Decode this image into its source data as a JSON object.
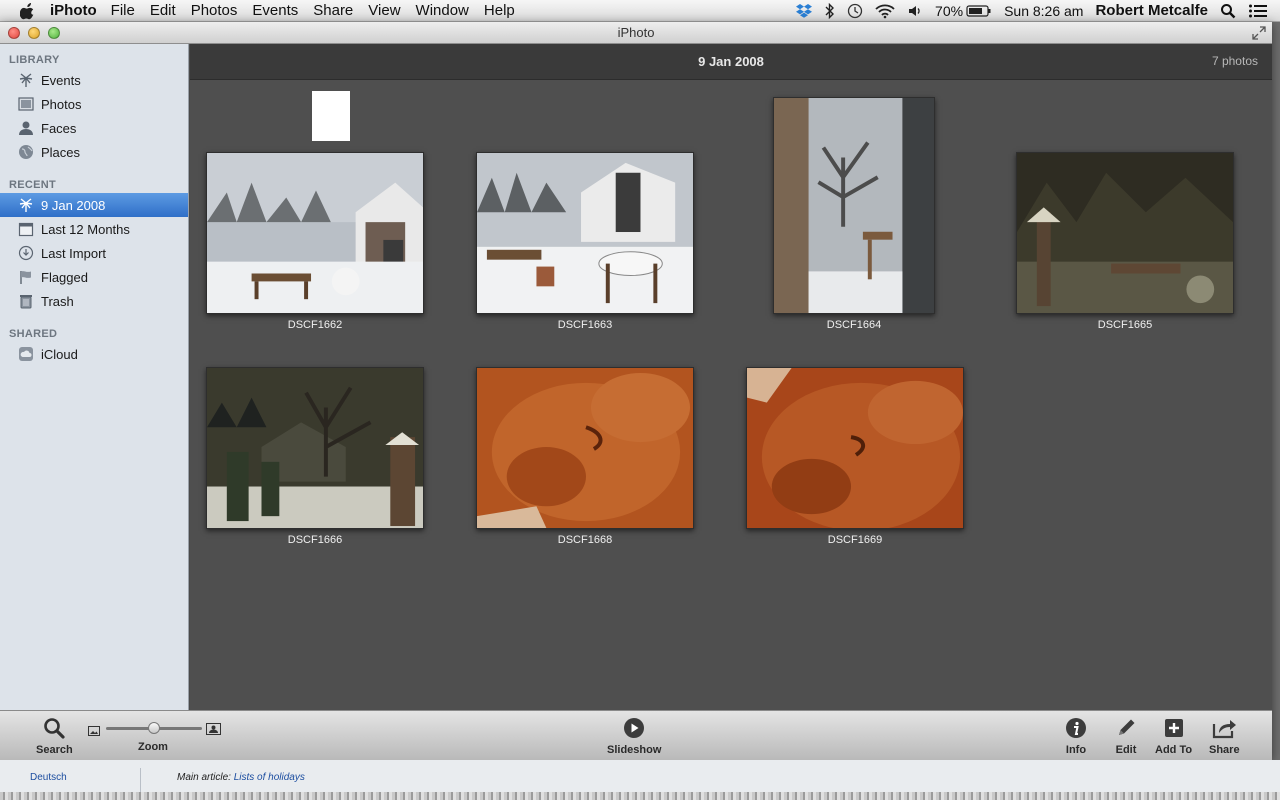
{
  "menubar": {
    "app_name": "iPhoto",
    "menus": [
      "File",
      "Edit",
      "Photos",
      "Events",
      "Share",
      "View",
      "Window",
      "Help"
    ],
    "battery": "70%",
    "clock": "Sun 8:26 am",
    "user": "Robert Metcalfe"
  },
  "window": {
    "title": "iPhoto"
  },
  "sidebar": {
    "library_header": "LIBRARY",
    "library_items": [
      {
        "label": "Events",
        "icon": "events-icon"
      },
      {
        "label": "Photos",
        "icon": "photos-icon"
      },
      {
        "label": "Faces",
        "icon": "faces-icon"
      },
      {
        "label": "Places",
        "icon": "places-icon"
      }
    ],
    "recent_header": "RECENT",
    "recent_items": [
      {
        "label": "9 Jan 2008",
        "icon": "event-icon",
        "selected": true
      },
      {
        "label": "Last 12 Months",
        "icon": "calendar-icon"
      },
      {
        "label": "Last Import",
        "icon": "import-icon"
      },
      {
        "label": "Flagged",
        "icon": "flag-icon"
      },
      {
        "label": "Trash",
        "icon": "trash-icon"
      }
    ],
    "shared_header": "SHARED",
    "shared_items": [
      {
        "label": "iCloud",
        "icon": "icloud-icon"
      }
    ]
  },
  "main": {
    "event_title": "9 Jan 2008",
    "photo_count": "7 photos",
    "photos": [
      {
        "name": "DSCF1662"
      },
      {
        "name": "DSCF1663"
      },
      {
        "name": "DSCF1664"
      },
      {
        "name": "DSCF1665"
      },
      {
        "name": "DSCF1666"
      },
      {
        "name": "DSCF1668"
      },
      {
        "name": "DSCF1669"
      }
    ]
  },
  "toolbar": {
    "search": "Search",
    "zoom": "Zoom",
    "zoom_level": 0.5,
    "slideshow": "Slideshow",
    "info": "Info",
    "edit": "Edit",
    "add_to": "Add To",
    "share": "Share"
  },
  "background_page": {
    "language": "Deutsch",
    "article_prefix": "Main article: ",
    "article_link": "Lists of holidays"
  }
}
